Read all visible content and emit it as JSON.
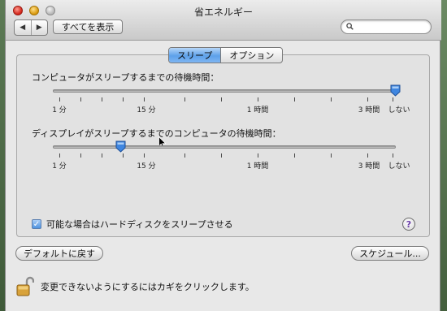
{
  "window": {
    "title": "省エネルギー"
  },
  "toolbar": {
    "back_glyph": "◀",
    "forward_glyph": "▶",
    "show_all_label": "すべてを表示",
    "search_placeholder": "",
    "search_value": ""
  },
  "tabs": [
    {
      "label": "スリープ",
      "selected": true
    },
    {
      "label": "オプション",
      "selected": false
    }
  ],
  "computer_sleep": {
    "label": "コンピュータがスリープするまでの待機時間：",
    "ticks": [
      "1 分",
      "15 分",
      "1 時間",
      "3 時間",
      "しない"
    ],
    "selected": "しない",
    "slider_fraction": 1.0
  },
  "display_sleep": {
    "label": "ディスプレイがスリープするまでのコンピュータの待機時間：",
    "ticks": [
      "1 分",
      "15 分",
      "1 時間",
      "3 時間",
      "しない"
    ],
    "selected": "15 分",
    "slider_fraction": 0.2
  },
  "hard_disk": {
    "label": "可能な場合はハードディスクをスリープさせる",
    "checked": true,
    "check_glyph": "✓"
  },
  "help_glyph": "?",
  "buttons": {
    "defaults_label": "デフォルトに戻す",
    "schedule_label": "スケジュール..."
  },
  "lock_text": "変更できないようにするにはカギをクリックします。",
  "colors": {
    "accent_blue": "#5da1ea",
    "thumb_blue": "#3f86e0",
    "help_purple": "#6a3da8"
  }
}
